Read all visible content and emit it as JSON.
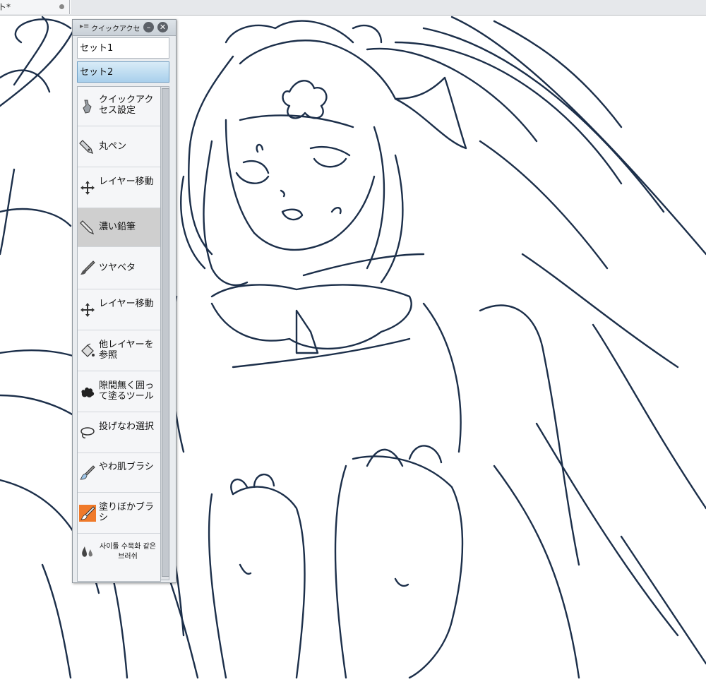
{
  "document_tab": {
    "title": "ト*"
  },
  "palette": {
    "title": "クイックアクセ",
    "sets": [
      "セット1",
      "セット2"
    ],
    "selected_set": "セット2",
    "items": [
      {
        "label": "クイックアクセス設定",
        "icon": "settings-hand-icon"
      },
      {
        "label": "丸ペン",
        "icon": "pen-nib-icon"
      },
      {
        "label": "レイヤー移動",
        "icon": "move-layer-icon"
      },
      {
        "label": "濃い鉛筆",
        "icon": "pencil-icon"
      },
      {
        "label": "ツヤベタ",
        "icon": "brush-icon"
      },
      {
        "label": "レイヤー移動",
        "icon": "move-layer-icon"
      },
      {
        "label": "他レイヤーを参照",
        "icon": "fill-bucket-icon"
      },
      {
        "label": "隙間無く囲って塗るツール",
        "icon": "fill-splat-icon"
      },
      {
        "label": "投げなわ選択",
        "icon": "lasso-icon"
      },
      {
        "label": "やわ肌ブラシ",
        "icon": "soft-brush-icon"
      },
      {
        "label": "塗りぼかブラシ",
        "icon": "blend-brush-icon"
      },
      {
        "label": "사이툴 수묵화 같은 브러쉬",
        "icon": "ink-drops-icon"
      }
    ],
    "selected_item": "濃い鉛筆"
  },
  "colors": {
    "line_art": "#1c2f4a",
    "selection": "#a9d0ec"
  }
}
